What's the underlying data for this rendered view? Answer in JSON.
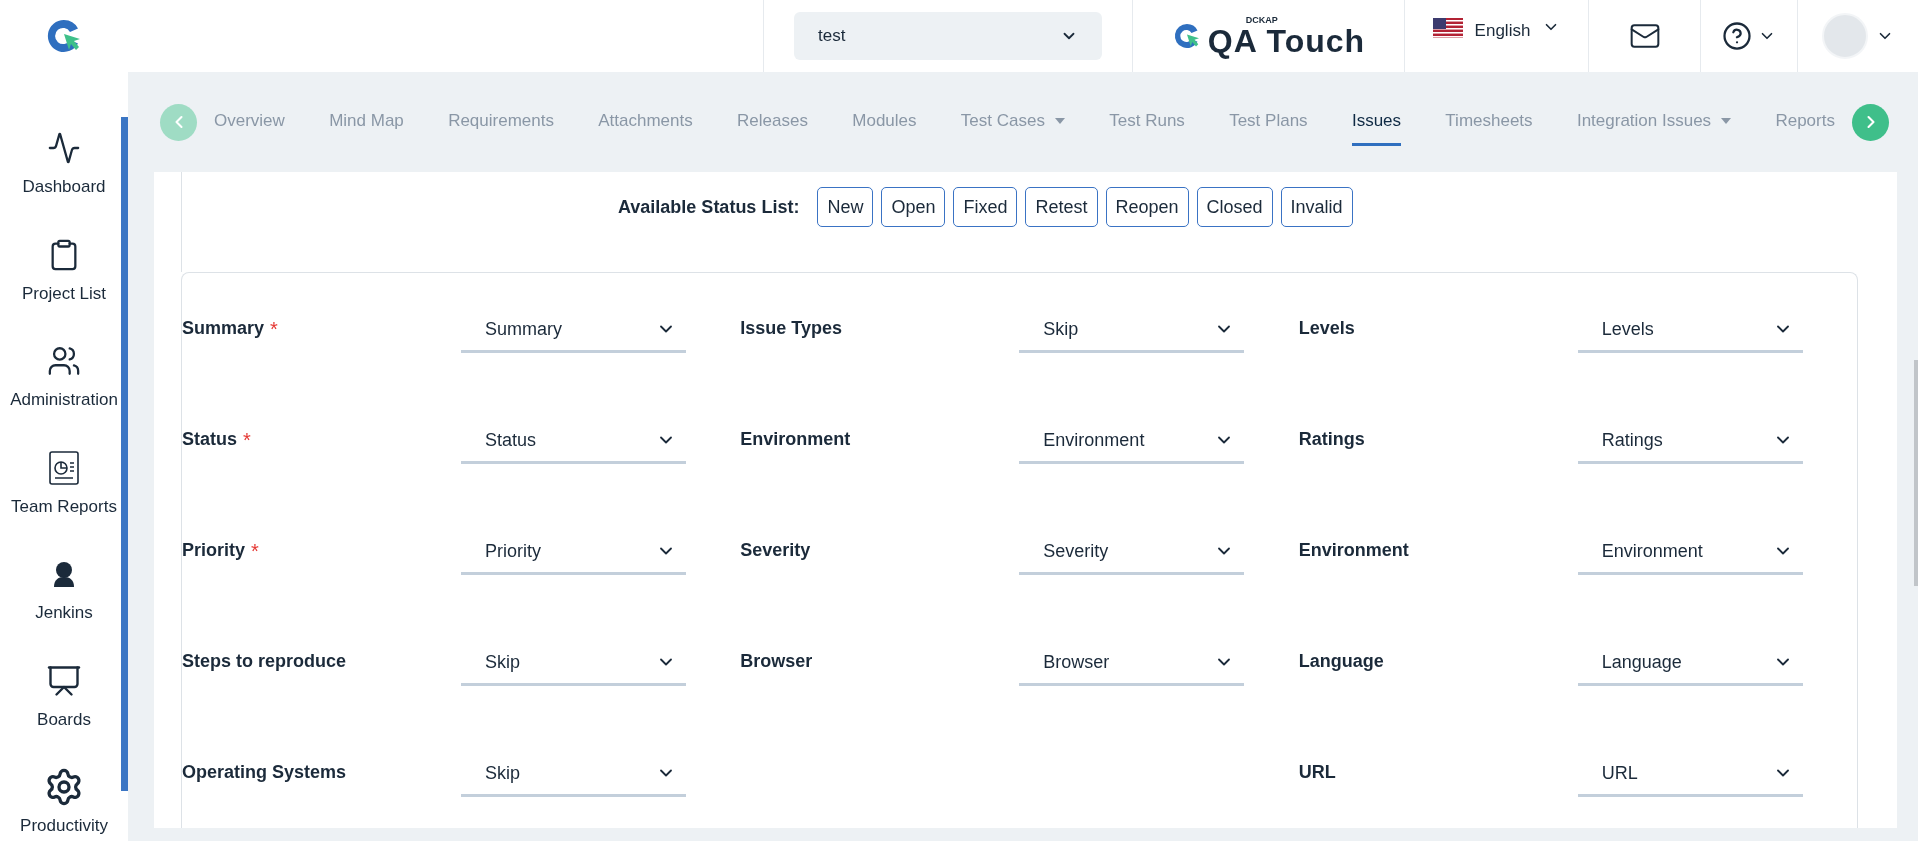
{
  "header": {
    "project_select": {
      "value": "test"
    },
    "brand": {
      "maker": "DCKAP",
      "name": "QA Touch"
    },
    "language": "English"
  },
  "sidebar": {
    "items": [
      {
        "label": "Dashboard",
        "kind": "pulse"
      },
      {
        "label": "Project List",
        "kind": "clipboard"
      },
      {
        "label": "Administration",
        "kind": "users"
      },
      {
        "label": "Team Reports",
        "kind": "report"
      },
      {
        "label": "Jenkins",
        "kind": "person"
      },
      {
        "label": "Boards",
        "kind": "board"
      },
      {
        "label": "Productivity",
        "kind": "gear"
      }
    ]
  },
  "tabs": [
    {
      "label": "Overview",
      "selected": false,
      "dropdown": false
    },
    {
      "label": "Mind Map",
      "selected": false,
      "dropdown": false
    },
    {
      "label": "Requirements",
      "selected": false,
      "dropdown": false
    },
    {
      "label": "Attachments",
      "selected": false,
      "dropdown": false
    },
    {
      "label": "Releases",
      "selected": false,
      "dropdown": false
    },
    {
      "label": "Modules",
      "selected": false,
      "dropdown": false
    },
    {
      "label": "Test Cases",
      "selected": false,
      "dropdown": true
    },
    {
      "label": "Test Runs",
      "selected": false,
      "dropdown": false
    },
    {
      "label": "Test Plans",
      "selected": false,
      "dropdown": false
    },
    {
      "label": "Issues",
      "selected": true,
      "dropdown": false
    },
    {
      "label": "Timesheets",
      "selected": false,
      "dropdown": false
    },
    {
      "label": "Integration Issues",
      "selected": false,
      "dropdown": true
    },
    {
      "label": "Reports",
      "selected": false,
      "dropdown": false
    }
  ],
  "status_list": {
    "label": "Available Status List:",
    "items": [
      "New",
      "Open",
      "Fixed",
      "Retest",
      "Reopen",
      "Closed",
      "Invalid"
    ]
  },
  "mapping_columns": [
    [
      {
        "label": "Summary",
        "required_mark": "*",
        "value": "Summary"
      },
      {
        "label": "Status",
        "required_mark": "*",
        "value": "Status"
      },
      {
        "label": "Priority",
        "required_mark": "*",
        "value": "Priority"
      },
      {
        "label": "Steps to reproduce",
        "value": "Skip"
      },
      {
        "label": "Operating Systems",
        "value": "Skip"
      }
    ],
    [
      {
        "label": "Issue Types",
        "value": "Skip"
      },
      {
        "label": "Environment",
        "value": "Environment"
      },
      {
        "label": "Severity",
        "value": "Severity"
      },
      {
        "label": "Browser",
        "value": "Browser"
      }
    ],
    [
      {
        "label": "Levels",
        "value": "Levels"
      },
      {
        "label": "Ratings",
        "value": "Ratings"
      },
      {
        "label": "Environment",
        "value": "Environment"
      },
      {
        "label": "Language",
        "value": "Language"
      },
      {
        "label": "URL",
        "value": "URL"
      }
    ]
  ]
}
